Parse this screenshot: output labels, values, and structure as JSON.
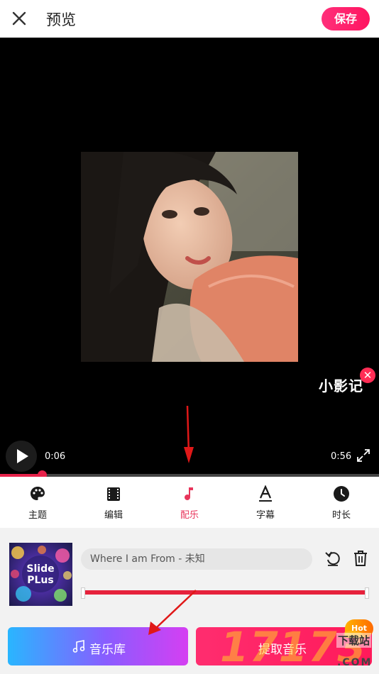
{
  "header": {
    "title": "预览",
    "save_label": "保存"
  },
  "player": {
    "current_time": "0:06",
    "total_time": "0:56",
    "progress": 0.11,
    "watermark_text": "小影记",
    "watermark_close": "✕"
  },
  "tabs": [
    {
      "label": "主题",
      "icon": "palette-icon",
      "active": false
    },
    {
      "label": "编辑",
      "icon": "film-icon",
      "active": false
    },
    {
      "label": "配乐",
      "icon": "music-note-icon",
      "active": true
    },
    {
      "label": "字幕",
      "icon": "text-icon",
      "active": false
    },
    {
      "label": "时长",
      "icon": "clock-icon",
      "active": false
    }
  ],
  "music": {
    "thumb_text": "Slide Plus",
    "track_name": "Where I am From - 未知",
    "range_start": 0.0,
    "range_end": 1.0
  },
  "buttons": {
    "library_label": "音乐库",
    "extract_label": "提取音乐",
    "hot_badge": "Hot"
  },
  "site_watermark": {
    "big": "17173",
    "top": "下载站",
    "domain": ".COM"
  },
  "colors": {
    "accent": "#e6224a",
    "save": "#ff1f6a",
    "library_start": "#29b6ff",
    "library_end": "#d53ff2"
  }
}
